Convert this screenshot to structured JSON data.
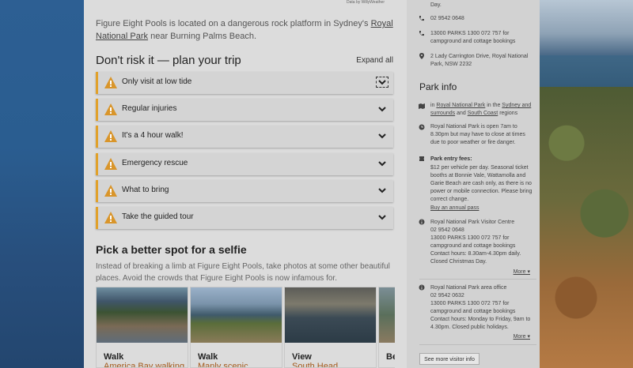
{
  "credit": "Data by WillyWeather",
  "intro": {
    "text_before": "Figure Eight Pools is located on a dangerous rock platform in Sydney's ",
    "link": "Royal National Park",
    "text_after": " near Burning Palms Beach."
  },
  "trip": {
    "title": "Don't risk it — plan your trip",
    "expand_all": "Expand all",
    "items": [
      {
        "label": "Only visit at low tide"
      },
      {
        "label": "Regular injuries"
      },
      {
        "label": "It's a 4 hour walk!"
      },
      {
        "label": "Emergency rescue"
      },
      {
        "label": "What to bring"
      },
      {
        "label": "Take the guided tour"
      }
    ]
  },
  "selfie": {
    "title": "Pick a better spot for a selfie",
    "desc": "Instead of breaking a limb at Figure Eight Pools, take photos at some other beautiful places. Avoid the crowds that Figure Eight Pools is now infamous for.",
    "cards": [
      {
        "kind": "Walk",
        "name": "America Bay walking"
      },
      {
        "kind": "Walk",
        "name": "Manly scenic"
      },
      {
        "kind": "View",
        "name": "South Head"
      },
      {
        "kind": "Be",
        "name": ""
      }
    ]
  },
  "side": {
    "top_day": "Day.",
    "phone1": "02 9542 0648",
    "phone2": "13000 PARKS 1300 072 757 for campground and cottage bookings",
    "address": "2 Lady Carrington Drive, Royal National Park, NSW 2232",
    "park_info_title": "Park info",
    "region_in": "in ",
    "region_link1": "Royal National Park",
    "region_mid": " in the ",
    "region_link2": "Sydney and surrounds",
    "region_and": " and ",
    "region_link3": "South Coast",
    "region_end": " regions",
    "hours": "Royal National Park is open 7am to 8.30pm but may have to close at times due to poor weather or fire danger.",
    "fees_title": "Park entry fees:",
    "fees_text": "$12 per vehicle per day. Seasonal ticket booths at Bonnie Vale, Wattamolla and Garie Beach are cash only, as there is no power or mobile connection. Please bring correct change.",
    "annual_pass": "Buy an annual pass",
    "visitor_centre": "Royal National Park Visitor Centre\n02 9542 0648\n13000 PARKS 1300 072 757 for campground and cottage bookings\nContact hours: 8.30am-4.30pm daily. Closed Christmas Day.",
    "more1": "More",
    "area_office": "Royal National Park area office\n02 9542 0632\n13000 PARKS 1300 072 757 for campground and cottage bookings\nContact hours: Monday to Friday, 9am to 4.30pm. Closed public holidays.",
    "more2": "More",
    "visitor_btn": "See more visitor info"
  },
  "colors": {
    "accent": "#e1a12a",
    "link_orange": "#a35a1c"
  }
}
